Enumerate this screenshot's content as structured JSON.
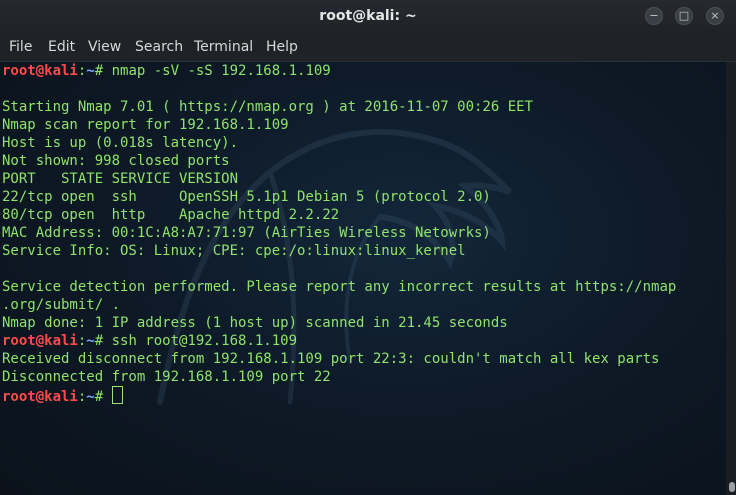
{
  "window": {
    "title": "root@kali: ~"
  },
  "menu": [
    "File",
    "Edit",
    "View",
    "Search",
    "Terminal",
    "Help"
  ],
  "prompt": {
    "user": "root@kali",
    "sep": ":",
    "path": "~",
    "symbol": "# "
  },
  "terminal_lines": [
    {
      "type": "cmd",
      "text": "nmap -sV -sS 192.168.1.109"
    },
    {
      "type": "out",
      "text": ""
    },
    {
      "type": "out",
      "text": "Starting Nmap 7.01 ( https://nmap.org ) at 2016-11-07 00:26 EET"
    },
    {
      "type": "out",
      "text": "Nmap scan report for 192.168.1.109"
    },
    {
      "type": "out",
      "text": "Host is up (0.018s latency)."
    },
    {
      "type": "out",
      "text": "Not shown: 998 closed ports"
    },
    {
      "type": "out",
      "text": "PORT   STATE SERVICE VERSION"
    },
    {
      "type": "out",
      "text": "22/tcp open  ssh     OpenSSH 5.1p1 Debian 5 (protocol 2.0)"
    },
    {
      "type": "out",
      "text": "80/tcp open  http    Apache httpd 2.2.22"
    },
    {
      "type": "out",
      "text": "MAC Address: 00:1C:A8:A7:71:97 (AirTies Wireless Netowrks)"
    },
    {
      "type": "out",
      "text": "Service Info: OS: Linux; CPE: cpe:/o:linux:linux_kernel"
    },
    {
      "type": "out",
      "text": ""
    },
    {
      "type": "out",
      "text": "Service detection performed. Please report any incorrect results at https://nmap"
    },
    {
      "type": "out",
      "text": ".org/submit/ ."
    },
    {
      "type": "out",
      "text": "Nmap done: 1 IP address (1 host up) scanned in 21.45 seconds"
    },
    {
      "type": "cmd",
      "text": "ssh root@192.168.1.109"
    },
    {
      "type": "out",
      "text": "Received disconnect from 192.168.1.109 port 22:3: couldn't match all kex parts"
    },
    {
      "type": "out",
      "text": "Disconnected from 192.168.1.109 port 22"
    },
    {
      "type": "cmd",
      "text": "",
      "cursor": true
    }
  ],
  "icons": {
    "minimize": "minimize-icon",
    "maximize": "maximize-icon",
    "close": "close-icon"
  },
  "colors": {
    "output": "#8fe36b",
    "prompt_user": "#ff4b4b",
    "prompt_path": "#7aa7ff",
    "background": "#0e1a28"
  }
}
